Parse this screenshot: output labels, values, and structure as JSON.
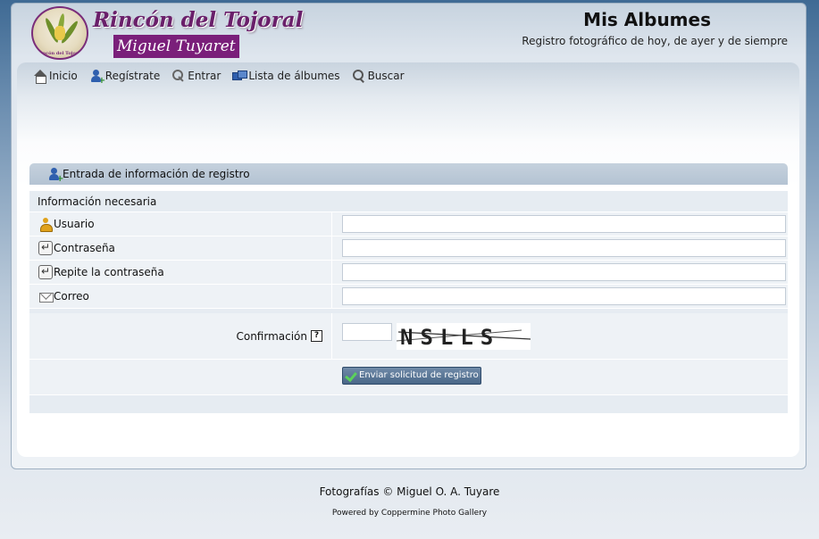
{
  "header": {
    "brand_title": "Rincón del Tojoral",
    "brand_subtitle": "Miguel Tuyaret",
    "logo_text": "Rincón del Tojoral",
    "site_title": "Mis Albumes",
    "site_description": "Registro fotográfico de hoy, de ayer y de siempre"
  },
  "nav": {
    "items": [
      {
        "label": "Inicio",
        "icon": "home-icon"
      },
      {
        "label": "Regístrate",
        "icon": "register-icon"
      },
      {
        "label": "Entrar",
        "icon": "key-icon"
      },
      {
        "label": "Lista de álbumes",
        "icon": "album-list-icon"
      },
      {
        "label": "Buscar",
        "icon": "search-icon"
      }
    ]
  },
  "form": {
    "header": "Entrada de información de registro",
    "section": "Información necesaria",
    "fields": [
      {
        "label": "Usuario",
        "icon": "user-icon",
        "value": ""
      },
      {
        "label": "Contraseña",
        "icon": "password-icon",
        "value": ""
      },
      {
        "label": "Repite la contraseña",
        "icon": "password-icon",
        "value": ""
      },
      {
        "label": "Correo",
        "icon": "mail-icon",
        "value": ""
      }
    ],
    "confirm_label": "Confirmación",
    "help_glyph": "?",
    "captcha_text": "NSLLS",
    "submit_label": "Enviar solicitud de registro"
  },
  "footer": {
    "copyright": "Fotografías © Miguel O. A. Tuyare",
    "powered_by": "Powered by Coppermine Photo Gallery"
  }
}
